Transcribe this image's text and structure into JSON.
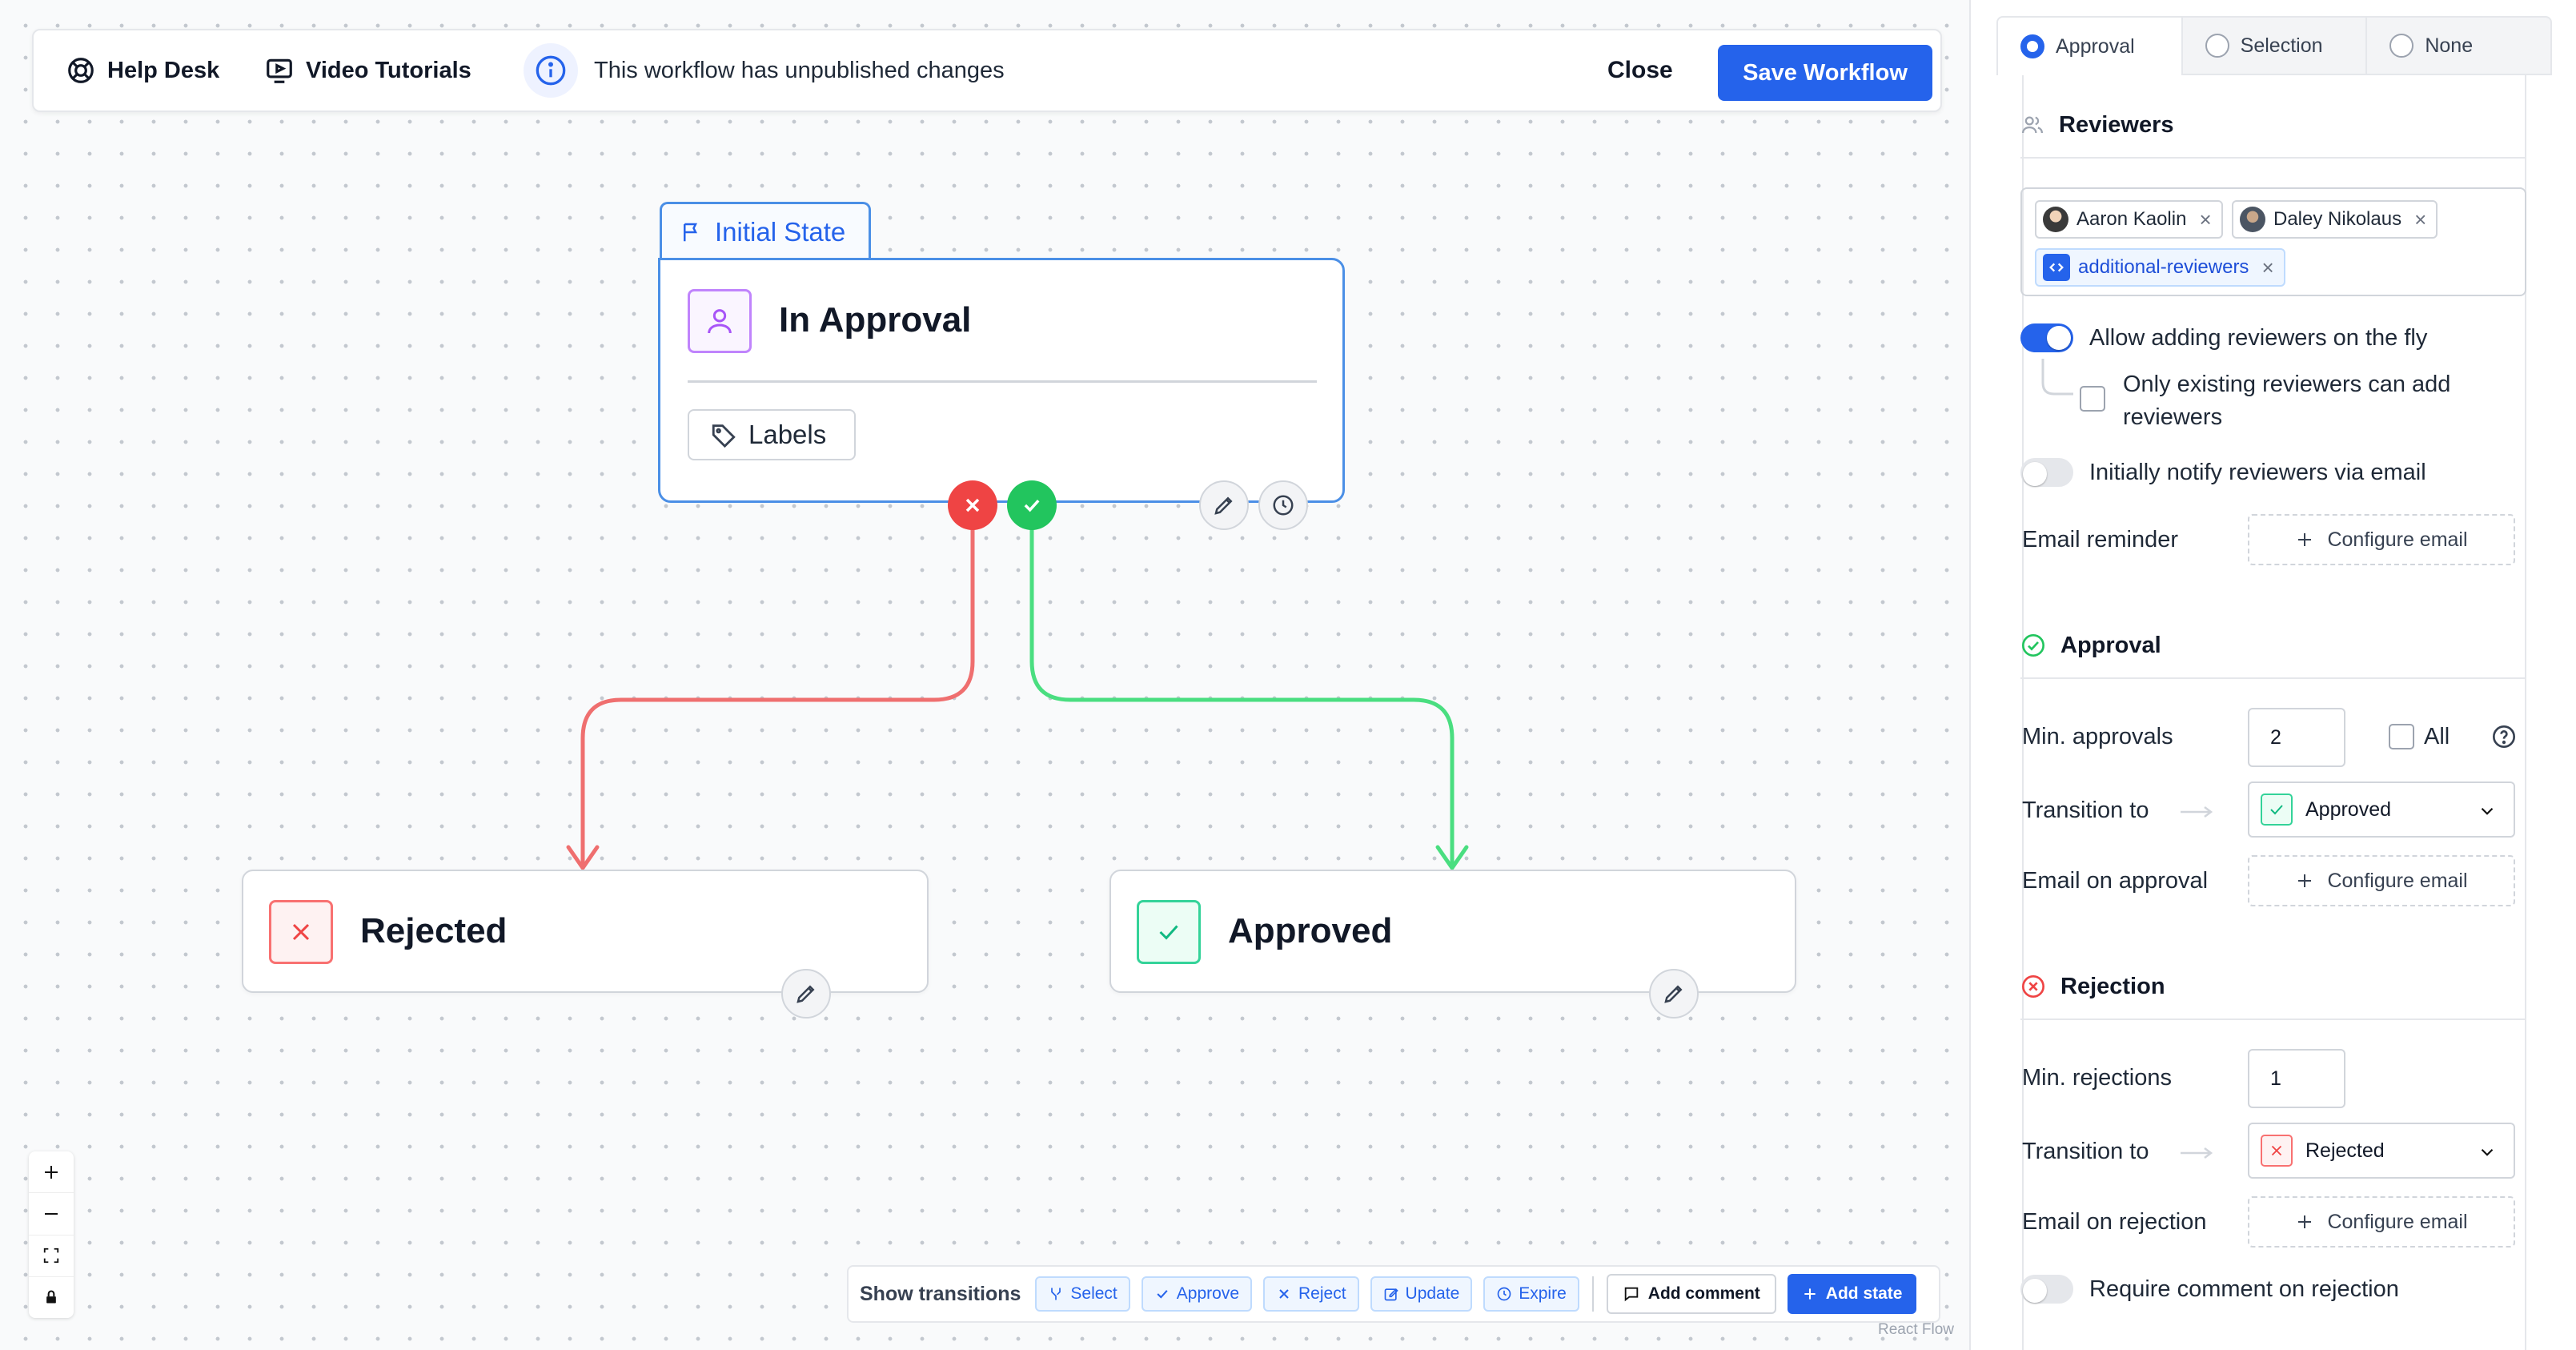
{
  "topbar": {
    "help_desk": "Help Desk",
    "video_tutorials": "Video Tutorials",
    "notice": "This workflow has unpublished changes",
    "close": "Close",
    "save": "Save Workflow"
  },
  "nodes": {
    "initial_tag": "Initial State",
    "approval_title": "In Approval",
    "labels_button": "Labels",
    "rejected_title": "Rejected",
    "approved_title": "Approved"
  },
  "edges": {
    "reject_color": "#ef6f6f",
    "approve_color": "#4ade80"
  },
  "bottombar": {
    "show_transitions": "Show transitions",
    "chips": [
      "Select",
      "Approve",
      "Reject",
      "Update",
      "Expire"
    ],
    "add_comment": "Add comment",
    "add_state": "Add state",
    "attribution": "React Flow"
  },
  "panel": {
    "tabs": [
      {
        "label": "Approval",
        "selected": true
      },
      {
        "label": "Selection",
        "selected": false
      },
      {
        "label": "None",
        "selected": false
      }
    ],
    "reviewers": {
      "heading": "Reviewers",
      "chips": [
        "Aaron Kaolin",
        "Daley Nikolaus",
        "additional-reviewers"
      ],
      "allow_adding": "Allow adding reviewers on the fly",
      "allow_adding_on": true,
      "only_existing": "Only existing reviewers can add reviewers",
      "only_existing_checked": false,
      "notify_email": "Initially notify reviewers via email",
      "notify_email_on": false,
      "email_reminder": "Email reminder",
      "configure_email": "Configure email"
    },
    "approval": {
      "heading": "Approval",
      "min_label": "Min. approvals",
      "min_value": "2",
      "all_label": "All",
      "all_checked": false,
      "transition_label": "Transition to",
      "transition_value": "Approved",
      "email_label": "Email on approval",
      "configure_email": "Configure email"
    },
    "rejection": {
      "heading": "Rejection",
      "min_label": "Min. rejections",
      "min_value": "1",
      "transition_label": "Transition to",
      "transition_value": "Rejected",
      "email_label": "Email on rejection",
      "configure_email": "Configure email",
      "require_comment": "Require comment on rejection",
      "require_comment_on": false
    }
  },
  "colors": {
    "primary": "#2563eb",
    "reject": "#ef4444",
    "approve": "#22c55e"
  }
}
